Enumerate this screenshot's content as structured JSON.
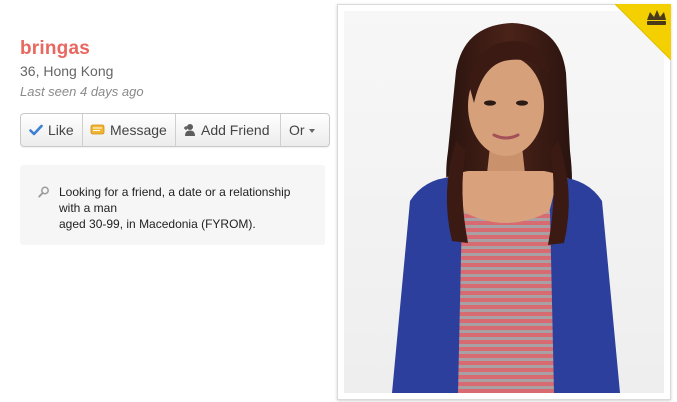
{
  "profile": {
    "name": "bringas",
    "age_location": "36, Hong Kong",
    "last_seen": "Last seen 4 days ago"
  },
  "actions": {
    "like_label": "Like",
    "message_label": "Message",
    "add_friend_label": "Add Friend",
    "or_label": "Or"
  },
  "looking_for": {
    "line1": "Looking for a friend, a date or a relationship",
    "line2": "with a man",
    "line3": "aged 30-99, in Macedonia (FYROM)."
  },
  "icons": {
    "like": "checkmark-icon",
    "message": "message-icon",
    "add_friend": "add-friend-icon",
    "dropdown": "caret-down-icon",
    "looking_for": "search-icon",
    "premium": "crown-icon"
  },
  "colors": {
    "name": "#e8675f",
    "like_check": "#3d7fd4",
    "message_icon": "#f2b632",
    "premium_corner": "#f5d000"
  }
}
